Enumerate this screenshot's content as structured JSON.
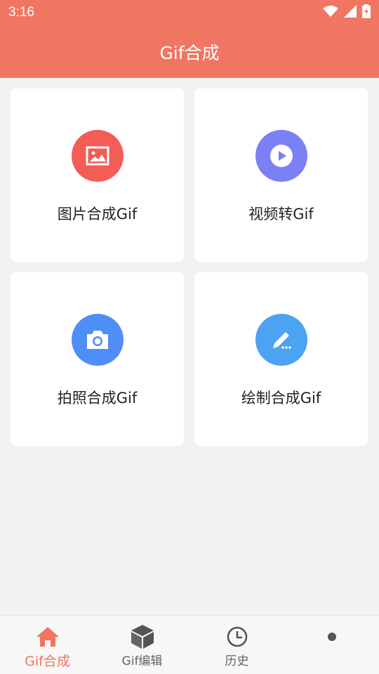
{
  "status_bar": {
    "time": "3:16"
  },
  "app_bar": {
    "title": "Gif合成"
  },
  "cards": [
    {
      "label": "图片合成Gif",
      "icon": "image-icon",
      "color": "#f45d55"
    },
    {
      "label": "视频转Gif",
      "icon": "play-icon",
      "color": "#7b80f5"
    },
    {
      "label": "拍照合成Gif",
      "icon": "camera-icon",
      "color": "#4f8ef7"
    },
    {
      "label": "绘制合成Gif",
      "icon": "pencil-icon",
      "color": "#4ba3f1"
    }
  ],
  "bottom_nav": {
    "items": [
      {
        "label": "Gif合成",
        "icon": "home-icon",
        "active": true
      },
      {
        "label": "Gif编辑",
        "icon": "box-icon",
        "active": false
      },
      {
        "label": "历史",
        "icon": "clock-icon",
        "active": false
      },
      {
        "label": "",
        "icon": "dot-icon",
        "active": false
      }
    ]
  },
  "colors": {
    "primary": "#f07563",
    "background": "#f2f2f2"
  }
}
